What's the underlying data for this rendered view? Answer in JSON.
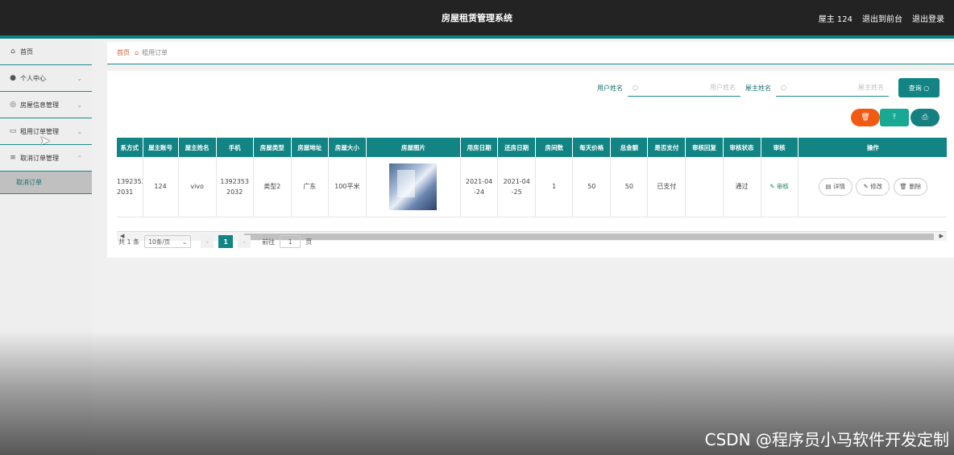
{
  "header": {
    "title": "房屋租赁管理系统",
    "user": "屋主 124",
    "front_link": "退出到前台",
    "logout": "退出登录"
  },
  "sidebar": {
    "items": [
      {
        "label": "首页",
        "icon": "home-icon"
      },
      {
        "label": "个人中心",
        "icon": "user-icon"
      },
      {
        "label": "房屋信息管理",
        "icon": "globe-icon"
      },
      {
        "label": "租用订单管理",
        "icon": "message-icon"
      },
      {
        "label": "取消订单管理",
        "icon": "list-icon"
      }
    ],
    "sub_item": "取消订单"
  },
  "breadcrumb": {
    "home": "首页",
    "current": "租用订单"
  },
  "search": {
    "label1": "用户姓名",
    "placeholder1": "用户姓名",
    "label2": "屋主姓名",
    "placeholder2": "屋主姓名",
    "button": "查询"
  },
  "actions": {
    "delete_icon": "trash-icon",
    "upload_icon": "upload-icon",
    "print_icon": "print-icon"
  },
  "table": {
    "headers": [
      "系方式",
      "屋主账号",
      "屋主姓名",
      "手机",
      "房屋类型",
      "房屋地址",
      "房屋大小",
      "房屋图片",
      "用房日期",
      "还房日期",
      "房间数",
      "每天价格",
      "总金额",
      "是否支付",
      "审核回复",
      "审核状态",
      "审核",
      "操作"
    ],
    "row": {
      "contact": "1392353\n2031",
      "owner_account": "124",
      "owner_name": "vivo",
      "phone": "1392353\n2032",
      "house_type": "类型2",
      "address": "广东",
      "size": "100平米",
      "start_date": "2021-04\n-24",
      "end_date": "2021-04\n-25",
      "rooms": "1",
      "daily_price": "50",
      "total": "50",
      "paid": "已支付",
      "reply": "",
      "status": "通过",
      "audit": "审核",
      "op_detail": "详情",
      "op_edit": "修改",
      "op_delete": "删除"
    }
  },
  "pagination": {
    "total": "共 1 条",
    "page_size": "10条/页",
    "current": "1",
    "goto_prefix": "前往",
    "goto_value": "1",
    "goto_suffix": "页"
  },
  "watermark": "CSDN @程序员小马软件开发定制",
  "colors": {
    "accent": "#128484",
    "danger": "#f25a12",
    "header": "#232323"
  }
}
